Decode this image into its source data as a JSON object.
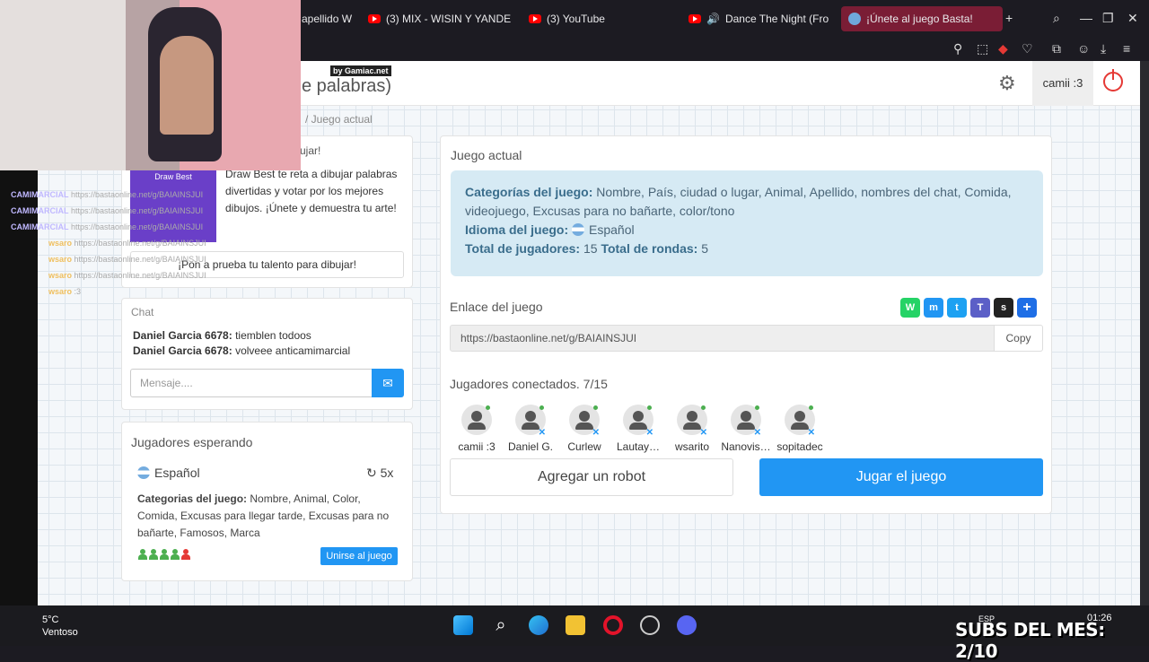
{
  "browser": {
    "tabs": [
      {
        "label": "apellido W"
      },
      {
        "label": "(3) MIX - WISIN Y YANDE"
      },
      {
        "label": "(3) YouTube"
      },
      {
        "label": "Dance The Night (Fro"
      },
      {
        "label": "¡Únete al juego Basta!"
      }
    ]
  },
  "header": {
    "title_partial": "e palabras)",
    "badge": "by Gamiac.net",
    "user_name": "camii :3",
    "breadcrumb": "/ Juego actual"
  },
  "drawbest": {
    "title_partial": "ujar!",
    "image_label": "Draw Best",
    "description": "Draw Best te reta a dibujar palabras divertidas y votar por los mejores dibujos. ¡Únete y demuestra tu arte!",
    "button": "¡Pon a prueba tu talento para dibujar!"
  },
  "chat": {
    "title": "Chat",
    "messages": [
      {
        "user": "Daniel Garcia 6678:",
        "text": "tiemblen todoos"
      },
      {
        "user": "Daniel Garcia 6678:",
        "text": "volveee anticamimarcial"
      }
    ],
    "placeholder": "Mensaje...."
  },
  "waiting": {
    "title": "Jugadores esperando",
    "language": "Español",
    "rounds": "5x",
    "categories_label": "Categorias del juego:",
    "categories": "Nombre, Animal, Color, Comida, Excusas para llegar tarde, Excusas para no bañarte, Famosos, Marca",
    "join_button": "Unirse al juego"
  },
  "game": {
    "title": "Juego actual",
    "categories_label": "Categorías del juego:",
    "categories": "Nombre, País, ciudad o lugar, Animal, Apellido, nombres del chat, Comida, videojuego, Excusas para no bañarte, color/tono",
    "language_label": "Idioma del juego:",
    "language": "Español",
    "players_label": "Total de jugadores:",
    "players": "15",
    "rounds_label": "Total de rondas:",
    "rounds": "5",
    "link_title": "Enlace del juego",
    "link": "https://bastaonline.net/g/BAIAINSJUI",
    "copy": "Copy",
    "connected_title": "Jugadores conectados. 7/15",
    "players_list": [
      "camii :3",
      "Daniel G.",
      "Curlew",
      "Lautay…",
      "wsarito",
      "Nanovis…",
      "sopitadec"
    ],
    "robot_button": "Agregar un robot",
    "play_button": "Jugar el juego"
  },
  "overlay": {
    "chat_lines": [
      {
        "user": "CAMIMARCIAL",
        "text": "https://bastaonline.net/g/BAIAINSJUI"
      },
      {
        "user": "CAMIMARCIAL",
        "text": "https://bastaonline.net/g/BAIAINSJUI"
      },
      {
        "user": "CAMIMARCIAL",
        "text": "https://bastaonline.net/g/BAIAINSJUI"
      },
      {
        "user": "wsaro",
        "text": "https://bastaonline.net/g/BAIAINSJUI"
      },
      {
        "user": "wsaro",
        "text": "https://bastaonline.net/g/BAIAINSJUI"
      },
      {
        "user": "wsaro",
        "text": "https://bastaonline.net/g/BAIAINSJUI"
      },
      {
        "user": "wsaro",
        "text": ":3"
      }
    ]
  },
  "taskbar": {
    "temperature": "5°C",
    "weather": "Ventoso",
    "subs": "SUBS DEL MES: 2/10",
    "time": "01:26",
    "lang": "ESP"
  },
  "colors": {
    "accent": "#2196f3",
    "info_bg": "#d6eaf4",
    "tab_active": "#7a1d35"
  }
}
